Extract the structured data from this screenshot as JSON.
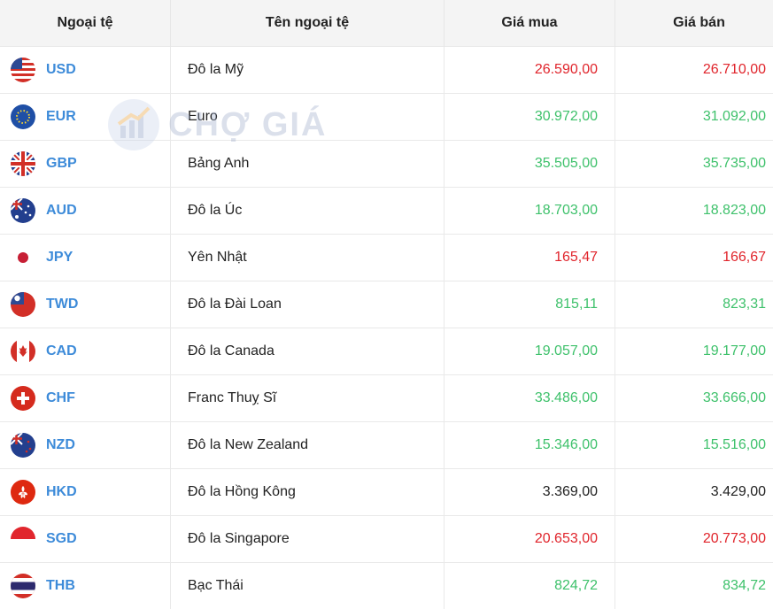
{
  "header": {
    "col_code": "Ngoại tệ",
    "col_name": "Tên ngoại tệ",
    "col_buy": "Giá mua",
    "col_sell": "Giá bán"
  },
  "watermark": {
    "text": "CHỢ GIÁ"
  },
  "colors": {
    "up": "#e0242b",
    "down": "#3ec16b",
    "same": "#222222",
    "code": "#3d8bd9"
  },
  "rows": [
    {
      "code": "USD",
      "name": "Đô la Mỹ",
      "buy": "26.590,00",
      "sell": "26.710,00",
      "trend": "up",
      "flag": "us-flag-icon"
    },
    {
      "code": "EUR",
      "name": "Euro",
      "buy": "30.972,00",
      "sell": "31.092,00",
      "trend": "down",
      "flag": "eu-flag-icon"
    },
    {
      "code": "GBP",
      "name": "Bảng Anh",
      "buy": "35.505,00",
      "sell": "35.735,00",
      "trend": "down",
      "flag": "uk-flag-icon"
    },
    {
      "code": "AUD",
      "name": "Đô la Úc",
      "buy": "18.703,00",
      "sell": "18.823,00",
      "trend": "down",
      "flag": "au-flag-icon"
    },
    {
      "code": "JPY",
      "name": "Yên Nhật",
      "buy": "165,47",
      "sell": "166,67",
      "trend": "up",
      "flag": "jp-flag-icon"
    },
    {
      "code": "TWD",
      "name": "Đô la Đài Loan",
      "buy": "815,11",
      "sell": "823,31",
      "trend": "down",
      "flag": "tw-flag-icon"
    },
    {
      "code": "CAD",
      "name": "Đô la Canada",
      "buy": "19.057,00",
      "sell": "19.177,00",
      "trend": "down",
      "flag": "ca-flag-icon"
    },
    {
      "code": "CHF",
      "name": "Franc Thuỵ Sĩ",
      "buy": "33.486,00",
      "sell": "33.666,00",
      "trend": "down",
      "flag": "ch-flag-icon"
    },
    {
      "code": "NZD",
      "name": "Đô la New Zealand",
      "buy": "15.346,00",
      "sell": "15.516,00",
      "trend": "down",
      "flag": "nz-flag-icon"
    },
    {
      "code": "HKD",
      "name": "Đô la Hồng Kông",
      "buy": "3.369,00",
      "sell": "3.429,00",
      "trend": "same",
      "flag": "hk-flag-icon"
    },
    {
      "code": "SGD",
      "name": "Đô la Singapore",
      "buy": "20.653,00",
      "sell": "20.773,00",
      "trend": "up",
      "flag": "sg-flag-icon"
    },
    {
      "code": "THB",
      "name": "Bạc Thái",
      "buy": "824,72",
      "sell": "834,72",
      "trend": "down",
      "flag": "th-flag-icon"
    }
  ]
}
